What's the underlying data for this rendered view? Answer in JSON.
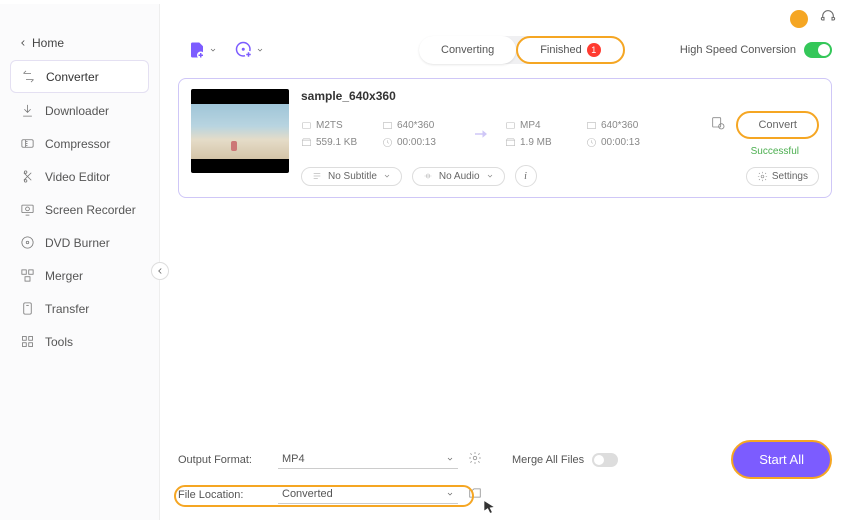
{
  "home_label": "Home",
  "sidebar": {
    "items": [
      {
        "label": "Converter"
      },
      {
        "label": "Downloader"
      },
      {
        "label": "Compressor"
      },
      {
        "label": "Video Editor"
      },
      {
        "label": "Screen Recorder"
      },
      {
        "label": "DVD Burner"
      },
      {
        "label": "Merger"
      },
      {
        "label": "Transfer"
      },
      {
        "label": "Tools"
      }
    ]
  },
  "tabs": {
    "converting": "Converting",
    "finished": "Finished",
    "finished_count": "1"
  },
  "highspeed_label": "High Speed Conversion",
  "task": {
    "title": "sample_640x360",
    "src": {
      "format": "M2TS",
      "resolution": "640*360",
      "size": "559.1 KB",
      "duration": "00:00:13"
    },
    "dst": {
      "format": "MP4",
      "resolution": "640*360",
      "size": "1.9 MB",
      "duration": "00:00:13"
    },
    "subtitle_label": "No Subtitle",
    "audio_label": "No Audio",
    "settings_label": "Settings",
    "convert_label": "Convert",
    "status": "Successful"
  },
  "bottom": {
    "output_label": "Output Format:",
    "output_value": "MP4",
    "location_label": "File Location:",
    "location_value": "Converted",
    "merge_label": "Merge All Files",
    "start_label": "Start All"
  }
}
